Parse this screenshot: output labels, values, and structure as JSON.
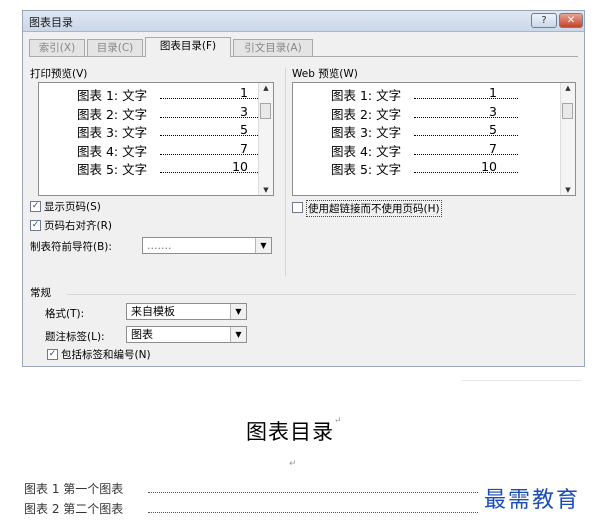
{
  "dialog": {
    "title": "图表目录",
    "help_label": "?",
    "close_label": "✕",
    "tabs": [
      {
        "label": "索引(X)"
      },
      {
        "label": "目录(C)"
      },
      {
        "label": "图表目录(F)"
      },
      {
        "label": "引文目录(A)"
      }
    ],
    "print_preview": {
      "label": "打印预览(V)",
      "entries": [
        {
          "text": "图表 1: 文字",
          "page": "1"
        },
        {
          "text": "图表 2: 文字",
          "page": "3"
        },
        {
          "text": "图表 3: 文字",
          "page": "5"
        },
        {
          "text": "图表 4: 文字",
          "page": "7"
        },
        {
          "text": "图表 5: 文字",
          "page": "10"
        }
      ]
    },
    "web_preview": {
      "label": "Web 预览(W)",
      "entries": [
        {
          "text": "图表 1: 文字",
          "page": "1"
        },
        {
          "text": "图表 2: 文字",
          "page": "3"
        },
        {
          "text": "图表 3: 文字",
          "page": "5"
        },
        {
          "text": "图表 4: 文字",
          "page": "7"
        },
        {
          "text": "图表 5: 文字",
          "page": "10"
        }
      ]
    },
    "show_page_numbers": {
      "label": "显示页码(S)",
      "checked": true
    },
    "right_align": {
      "label": "页码右对齐(R)",
      "checked": true
    },
    "tab_leader": {
      "label": "制表符前导符(B):",
      "value": "......."
    },
    "use_hyperlinks": {
      "label": "使用超链接而不使用页码(H)",
      "checked": false
    },
    "general": {
      "label": "常规",
      "format": {
        "label": "格式(T):",
        "value": "来自模板"
      },
      "caption": {
        "label": "题注标签(L):",
        "value": "图表"
      },
      "include_label": {
        "label": "包括标签和编号(N)",
        "checked": true
      }
    }
  },
  "document": {
    "title": "图表目录",
    "para_mark": "↵",
    "entries": [
      {
        "text": "图表 1 第一个图表"
      },
      {
        "text": "图表 2 第二个图表"
      }
    ]
  },
  "watermark": "最需教育",
  "colors": {
    "accent": "#1a4db8",
    "close": "#c4432a"
  }
}
